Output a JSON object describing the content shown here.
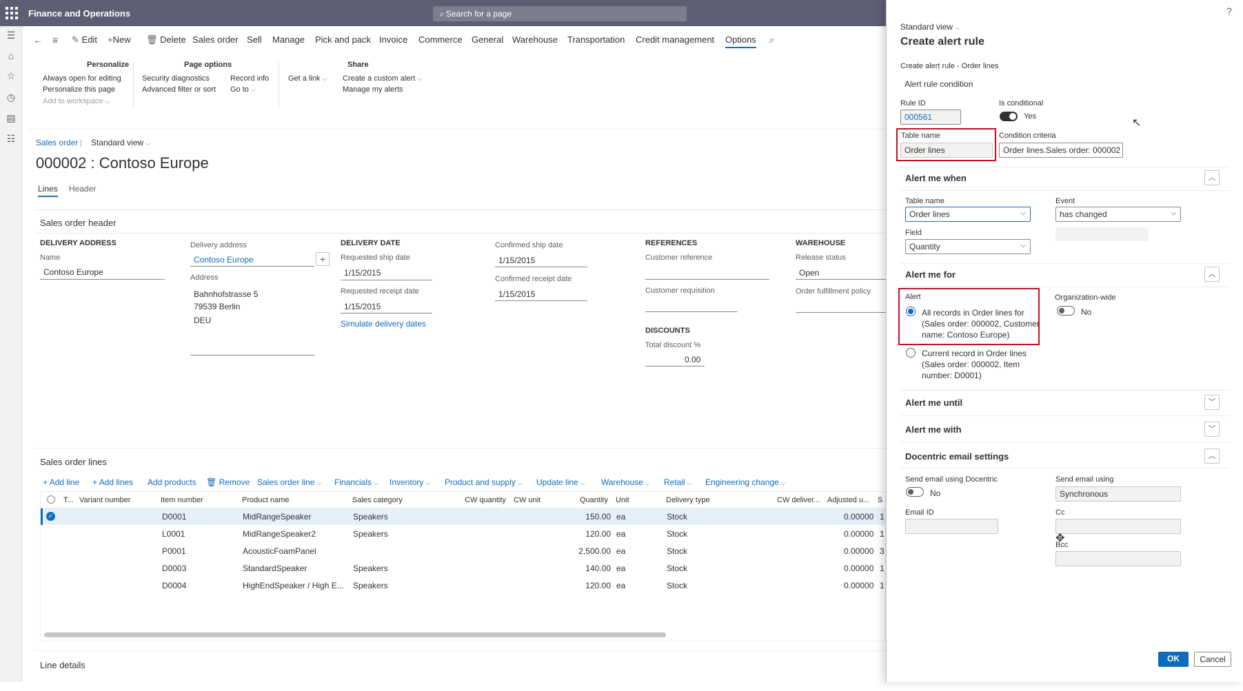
{
  "app": {
    "title": "Finance and Operations",
    "search_placeholder": "Search for a page"
  },
  "action_pane": {
    "edit": "Edit",
    "new": "New",
    "delete": "Delete",
    "tabs": [
      "Sales order",
      "Sell",
      "Manage",
      "Pick and pack",
      "Invoice",
      "Commerce",
      "General",
      "Warehouse",
      "Transportation",
      "Credit management",
      "Options"
    ],
    "selected_tab": "Options",
    "groups": {
      "personalize": {
        "header": "Personalize",
        "items": [
          "Always open for editing",
          "Personalize this page",
          "Add to workspace"
        ]
      },
      "page_options": {
        "header": "Page options",
        "items": [
          "Security diagnostics",
          "Advanced filter or sort",
          "Record info",
          "Go to"
        ]
      },
      "get_link": "Get a link",
      "share": {
        "header": "Share",
        "items": [
          "Create a custom alert",
          "Manage my alerts"
        ]
      }
    }
  },
  "page": {
    "breadcrumb": "Sales order",
    "view": "Standard view",
    "title": "000002 : Contoso Europe",
    "tabs": [
      "Lines",
      "Header"
    ]
  },
  "header_section": {
    "title": "Sales order header",
    "delivery_address": {
      "heading": "DELIVERY ADDRESS",
      "name_label": "Name",
      "name_value": "Contoso Europe"
    },
    "delivery_address_col": {
      "label": "Delivery address",
      "value": "Contoso Europe",
      "address_label": "Address",
      "address_lines": [
        "Bahnhofstrasse 5",
        "79539 Berlin",
        "DEU"
      ]
    },
    "delivery_date": {
      "heading": "DELIVERY DATE",
      "req_ship_label": "Requested ship date",
      "req_ship_value": "1/15/2015",
      "req_receipt_label": "Requested receipt date",
      "req_receipt_value": "1/15/2015",
      "simulate": "Simulate delivery dates"
    },
    "confirmed": {
      "ship_label": "Confirmed ship date",
      "ship_value": "1/15/2015",
      "receipt_label": "Confirmed receipt date",
      "receipt_value": "1/15/2015"
    },
    "references": {
      "heading": "REFERENCES",
      "cust_ref": "Customer reference",
      "cust_req": "Customer requisition"
    },
    "discounts": {
      "heading": "DISCOUNTS",
      "label": "Total discount %",
      "value": "0.00"
    },
    "warehouse": {
      "heading": "WAREHOUSE",
      "release_label": "Release status",
      "release_value": "Open",
      "policy_label": "Order fulfillment policy"
    }
  },
  "lines_section": {
    "title": "Sales order lines",
    "toolbar": [
      "Add line",
      "Add lines",
      "Add products",
      "Remove",
      "Sales order line",
      "Financials",
      "Inventory",
      "Product and supply",
      "Update line",
      "Warehouse",
      "Retail",
      "Engineering change"
    ],
    "columns": [
      "T...",
      "Variant number",
      "Item number",
      "Product name",
      "Sales category",
      "CW quantity",
      "CW unit",
      "Quantity",
      "Unit",
      "Delivery type",
      "CW deliver...",
      "Adjusted u...",
      "S"
    ],
    "rows": [
      {
        "item": "D0001",
        "product": "MidRangeSpeaker",
        "category": "Speakers",
        "qty": "150.00",
        "unit": "ea",
        "delivery": "Stock",
        "adjusted": "0.00000",
        "s": "1"
      },
      {
        "item": "L0001",
        "product": "MidRangeSpeaker2",
        "category": "Speakers",
        "qty": "120.00",
        "unit": "ea",
        "delivery": "Stock",
        "adjusted": "0.00000",
        "s": "1"
      },
      {
        "item": "P0001",
        "product": "AcousticFoamPanel",
        "category": "",
        "qty": "2,500.00",
        "unit": "ea",
        "delivery": "Stock",
        "adjusted": "0.00000",
        "s": "3"
      },
      {
        "item": "D0003",
        "product": "StandardSpeaker",
        "category": "Speakers",
        "qty": "140.00",
        "unit": "ea",
        "delivery": "Stock",
        "adjusted": "0.00000",
        "s": "1"
      },
      {
        "item": "D0004",
        "product": "HighEndSpeaker / High E...",
        "category": "Speakers",
        "qty": "120.00",
        "unit": "ea",
        "delivery": "Stock",
        "adjusted": "0.00000",
        "s": "1"
      }
    ],
    "line_details": "Line details"
  },
  "panel": {
    "help": "?",
    "view": "Standard view",
    "title": "Create alert rule",
    "subtitle": "Create alert rule - Order lines",
    "condition_link": "Alert rule condition",
    "rule_id_label": "Rule ID",
    "rule_id_value": "000561",
    "is_conditional_label": "Is conditional",
    "is_conditional_value": "Yes",
    "table_name_label": "Table name",
    "table_name_value": "Order lines",
    "criteria_label": "Condition criteria",
    "criteria_value": "Order lines.Sales order: 000002",
    "alert_when": {
      "heading": "Alert me when",
      "table_label": "Table name",
      "table_value": "Order lines",
      "event_label": "Event",
      "event_value": "has changed",
      "field_label": "Field",
      "field_value": "Quantity"
    },
    "alert_for": {
      "heading": "Alert me for",
      "alert_label": "Alert",
      "option1": [
        "All records in Order lines for",
        "(Sales order: 000002, Customer",
        "name: Contoso Europe)"
      ],
      "option2": [
        "Current record in Order lines",
        "(Sales order: 000002, Item",
        "number: D0001)"
      ],
      "org_label": "Organization-wide",
      "org_value": "No"
    },
    "alert_until": "Alert me until",
    "alert_with": "Alert me with",
    "docentric": {
      "heading": "Docentric email settings",
      "send_docentric_label": "Send email using Docentric",
      "send_docentric_value": "No",
      "send_using_label": "Send email using",
      "send_using_value": "Synchronous",
      "email_id_label": "Email ID",
      "cc_label": "Cc",
      "bcc_label": "Bcc"
    },
    "ok": "OK",
    "cancel": "Cancel"
  },
  "colors": {
    "accent": "#0f6cbd",
    "topbar": "#5e5e72",
    "highlight": "#c50f1f"
  }
}
